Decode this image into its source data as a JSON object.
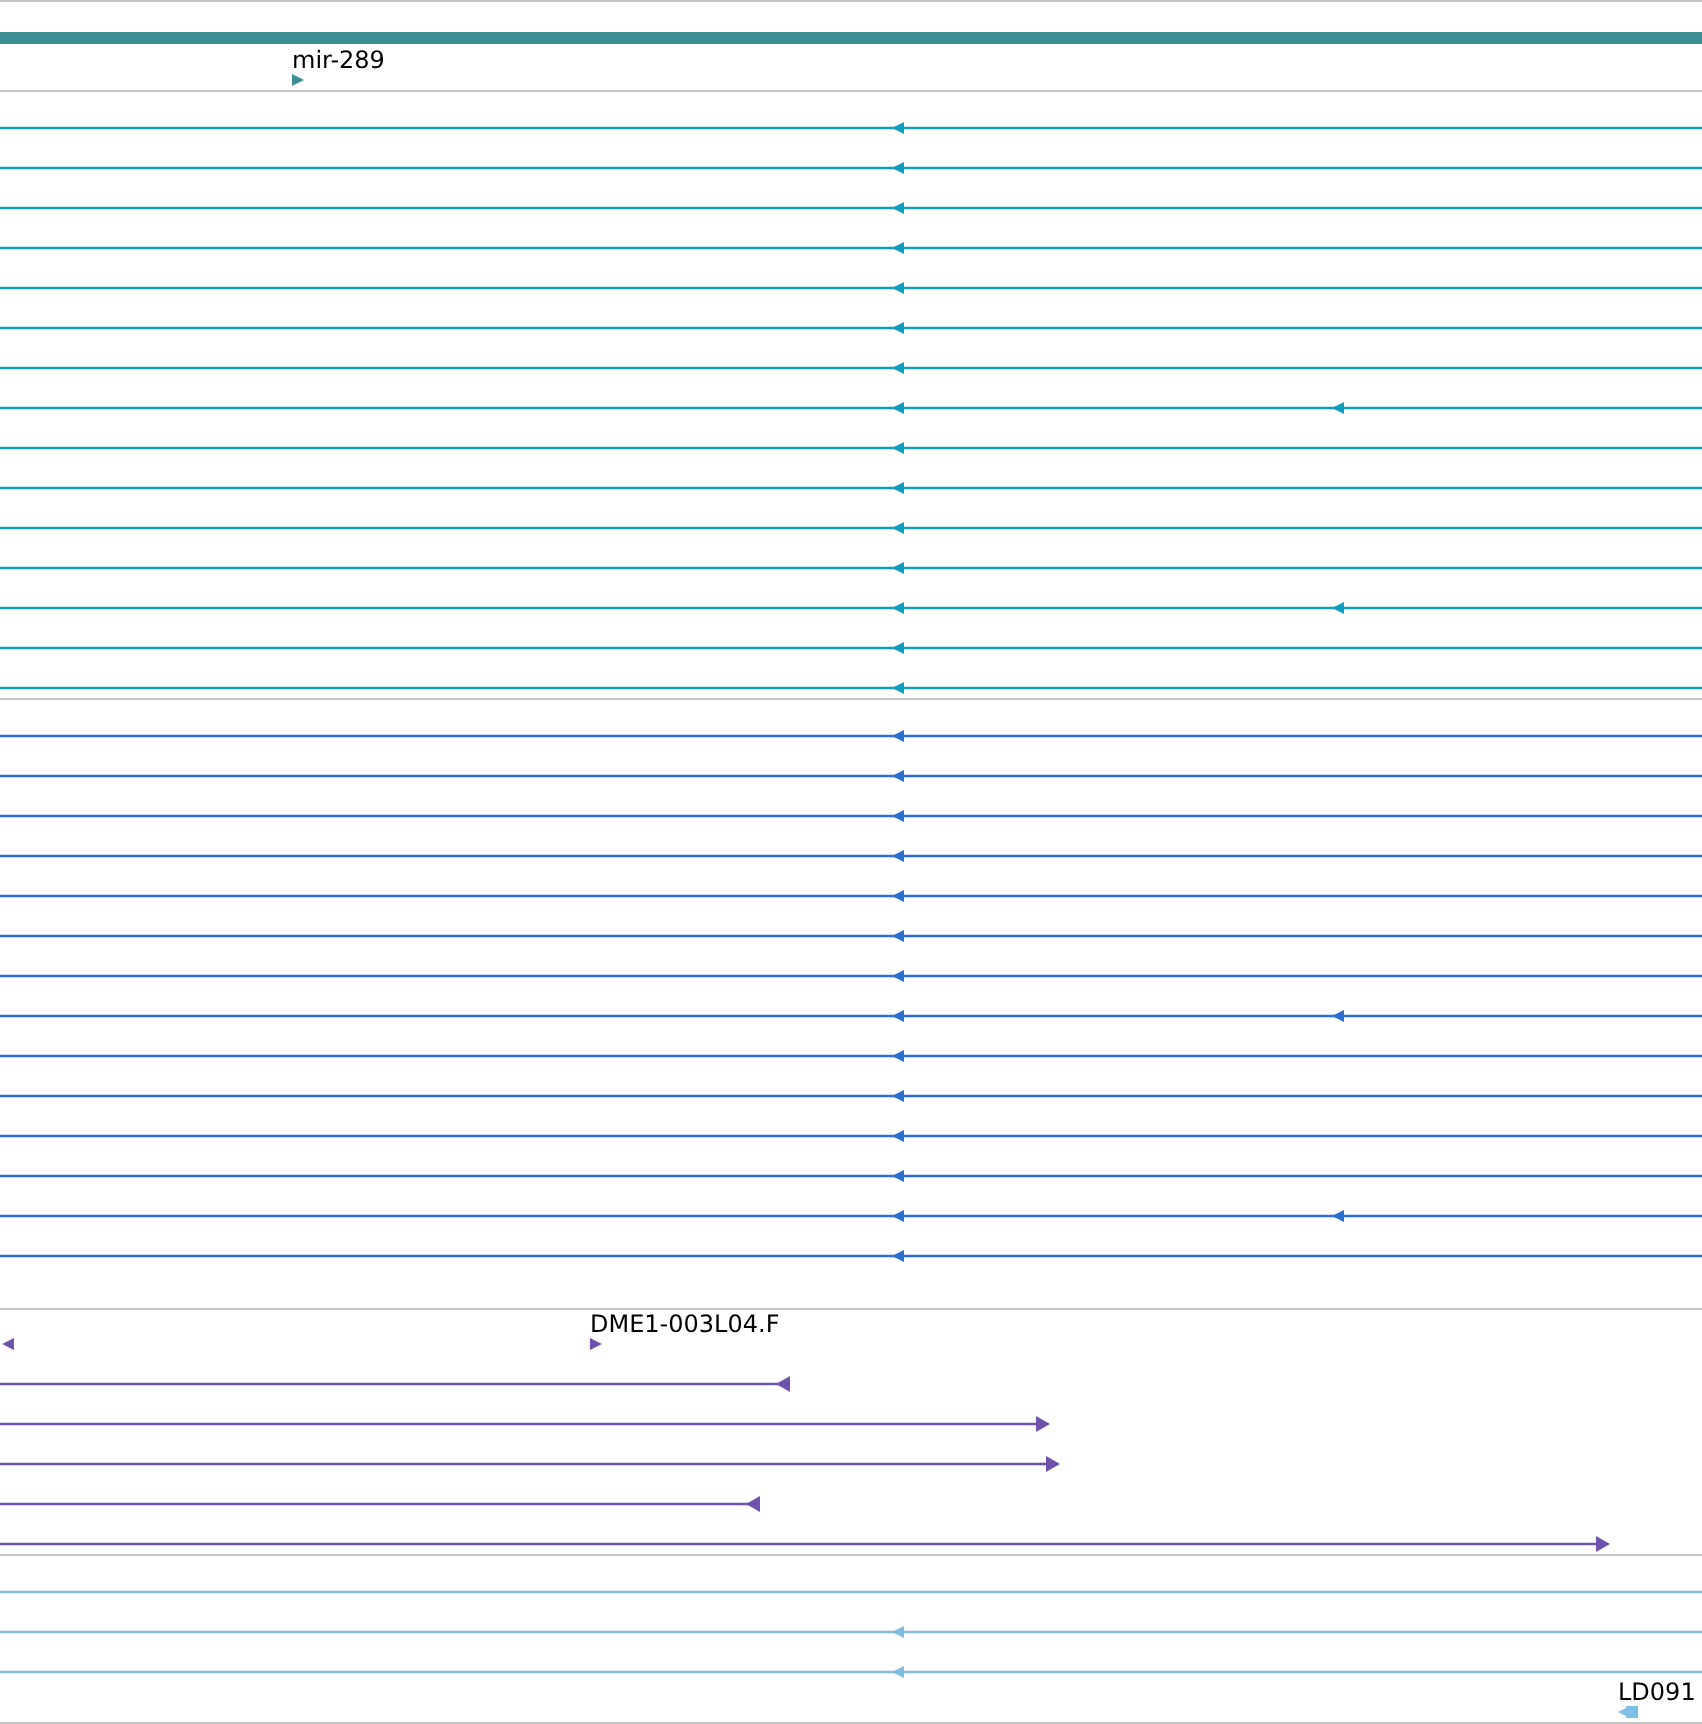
{
  "gene_track": {
    "label": "mir-289",
    "color": "#3d8f93",
    "kind": "plus"
  },
  "tracks": [
    {
      "kind": "transcripts",
      "color": "#0e9fc0",
      "features": [
        {
          "kind": "minus"
        },
        {
          "kind": "minus"
        },
        {
          "kind": "minus"
        },
        {
          "kind": "minus"
        },
        {
          "kind": "minus"
        },
        {
          "kind": "minus"
        },
        {
          "kind": "minus"
        },
        {
          "kind": "minus"
        },
        {
          "kind": "minus"
        },
        {
          "kind": "minus"
        },
        {
          "kind": "minus"
        },
        {
          "kind": "minus"
        },
        {
          "kind": "minus"
        },
        {
          "kind": "minus"
        },
        {
          "kind": "minus"
        }
      ]
    },
    {
      "kind": "transcripts",
      "color": "#2a6fcf",
      "features": [
        {
          "kind": "minus"
        },
        {
          "kind": "minus"
        },
        {
          "kind": "minus"
        },
        {
          "kind": "minus"
        },
        {
          "kind": "minus"
        },
        {
          "kind": "minus"
        },
        {
          "kind": "minus"
        },
        {
          "kind": "minus"
        },
        {
          "kind": "minus"
        },
        {
          "kind": "minus"
        },
        {
          "kind": "minus"
        },
        {
          "kind": "minus"
        },
        {
          "kind": "minus"
        },
        {
          "kind": "minus"
        }
      ]
    },
    {
      "kind": "clones",
      "color": "#6f52ad",
      "label": "DME1-003L04.F",
      "features": [
        {
          "kind": "minus"
        },
        {
          "kind": "plus"
        },
        {
          "kind": "plus"
        },
        {
          "kind": "minus"
        },
        {
          "kind": "plus"
        }
      ]
    },
    {
      "kind": "ests",
      "color": "#80bde2",
      "label": "LD091",
      "features": [
        {
          "kind": "none"
        },
        {
          "kind": "minus"
        },
        {
          "kind": "minus"
        }
      ]
    }
  ]
}
